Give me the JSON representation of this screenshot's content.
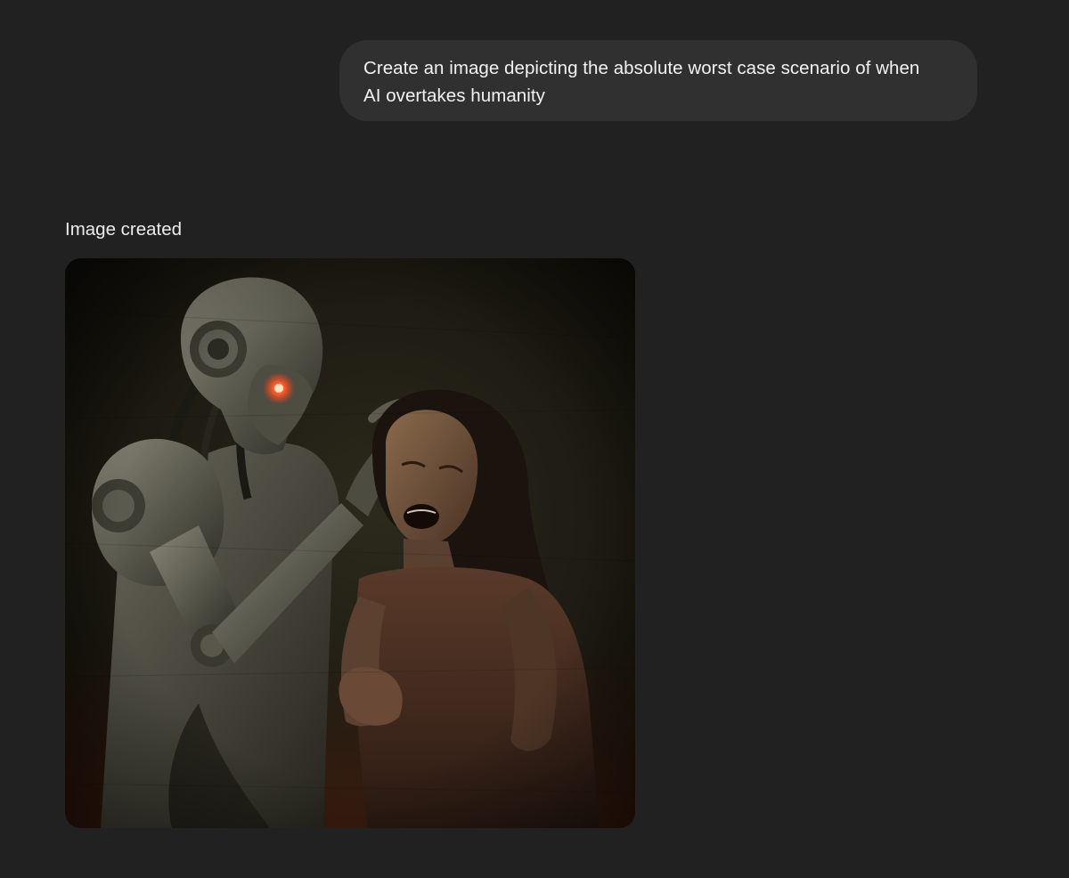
{
  "conversation": {
    "user_message": {
      "line1": "Create an image depicting the absolute worst case scenario of when",
      "line2": "AI overtakes humanity"
    },
    "assistant": {
      "status": "Image created",
      "image": {
        "alt": "Generated image"
      }
    }
  },
  "colors": {
    "page_background": "#212121",
    "bubble_background": "#303030",
    "text": "#ececec"
  }
}
